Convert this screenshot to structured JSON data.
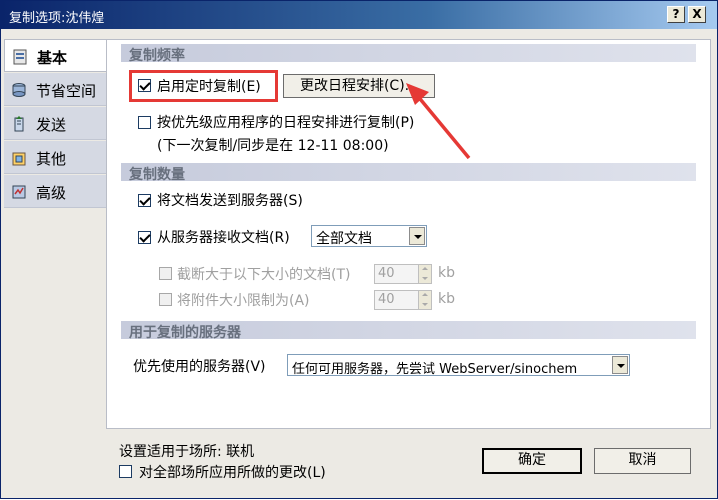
{
  "window": {
    "title": "复制选项:沈伟煌",
    "help_label": "?",
    "close_label": "X"
  },
  "sidebar": {
    "items": [
      {
        "label": "基本",
        "icon": "basic-icon",
        "active": true
      },
      {
        "label": "节省空间",
        "icon": "disk-icon"
      },
      {
        "label": "发送",
        "icon": "send-icon"
      },
      {
        "label": "其他",
        "icon": "other-icon"
      },
      {
        "label": "高级",
        "icon": "advanced-icon"
      }
    ]
  },
  "frequency": {
    "header": "复制频率",
    "scheduled_label": "启用定时复制(E)",
    "scheduled_checked": true,
    "change_schedule_button": "更改日程安排(C)...",
    "priority_label": "按优先级应用程序的日程安排进行复制(P)",
    "priority_checked": false,
    "next_replication": "(下一次复制/同步是在 12-11 08:00)"
  },
  "amount": {
    "header": "复制数量",
    "send_docs_label": "将文档发送到服务器(S)",
    "send_docs_checked": true,
    "receive_docs_label": "从服务器接收文档(R)",
    "receive_docs_checked": true,
    "receive_select_value": "全部文档",
    "truncate_label": "截断大于以下大小的文档(T)",
    "truncate_value": "40",
    "truncate_unit": "kb",
    "limit_attach_label": "将附件大小限制为(A)",
    "limit_attach_value": "40",
    "limit_attach_unit": "kb"
  },
  "servers": {
    "header": "用于复制的服务器",
    "preferred_label": "优先使用的服务器(V)",
    "preferred_value": "任何可用服务器，先尝试 WebServer/sinochem"
  },
  "footer": {
    "location_text": "设置适用于场所: 联机",
    "apply_all_label": "对全部场所应用所做的更改(L)",
    "ok_button": "确定",
    "cancel_button": "取消"
  },
  "colors": {
    "accent_red": "#e53935",
    "section_bg": "#c6cbdc",
    "titlebar": "#0a246a"
  }
}
